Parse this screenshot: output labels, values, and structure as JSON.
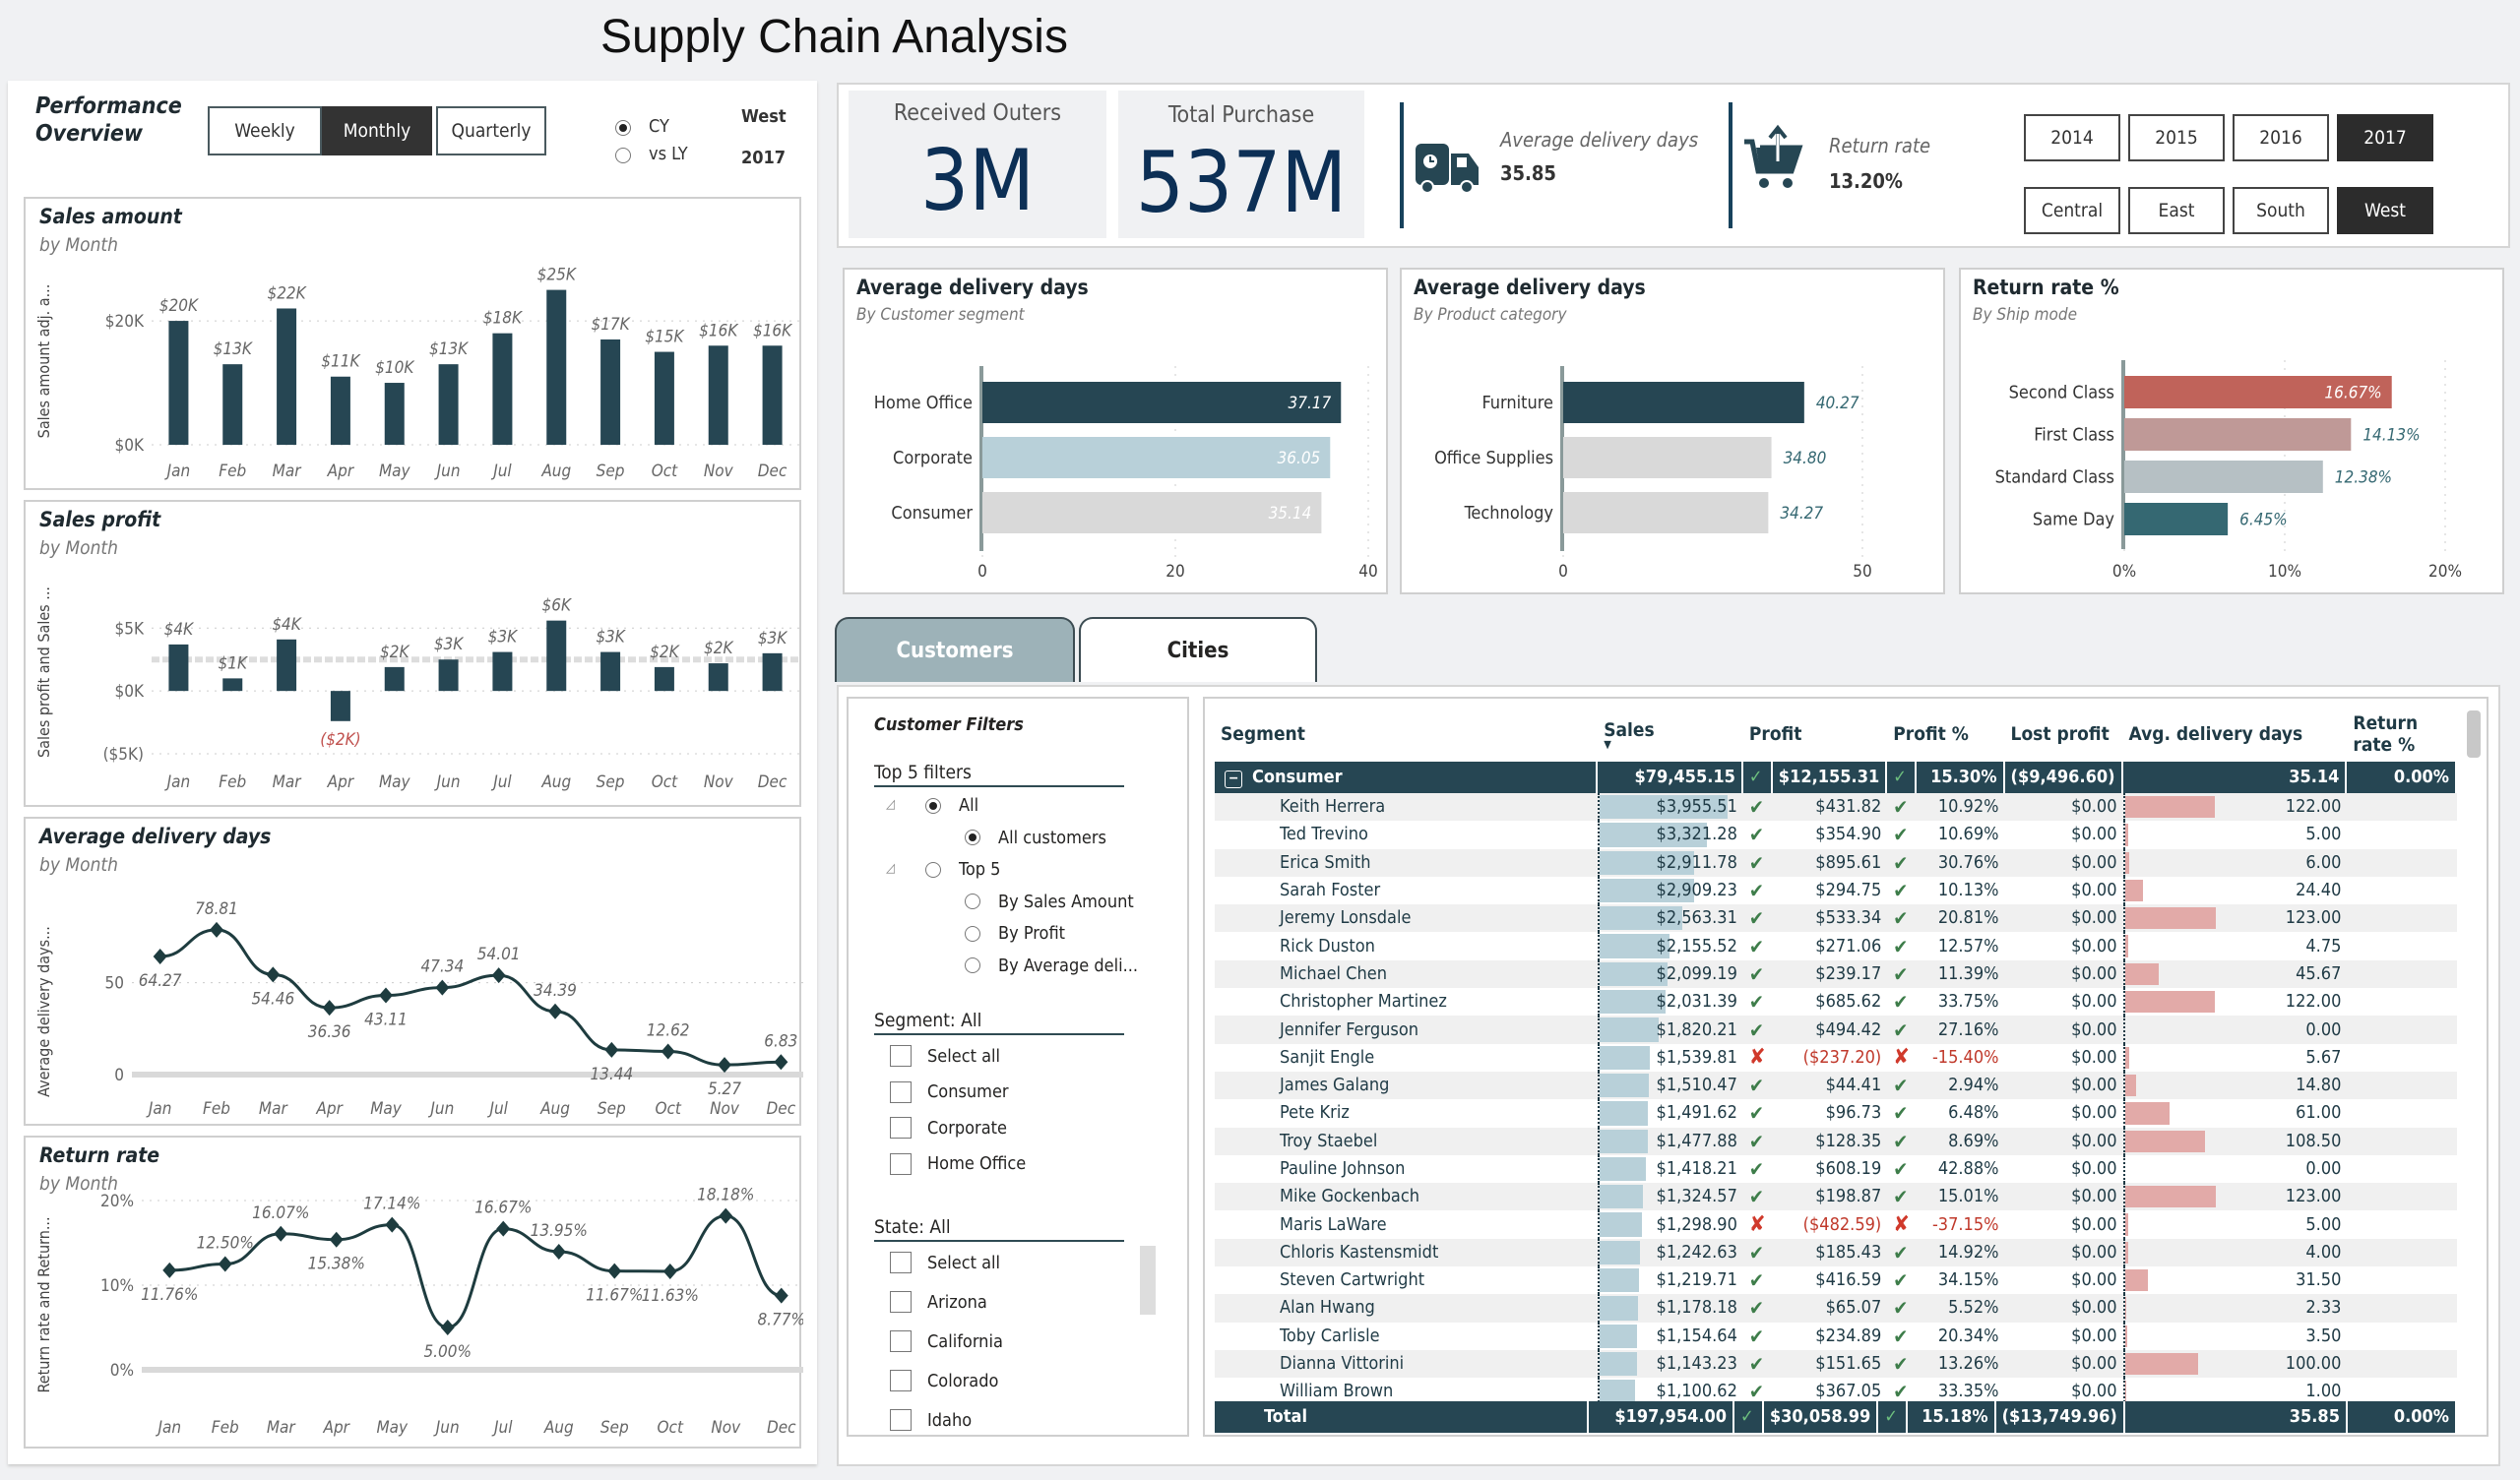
{
  "page_title": "Supply Chain Analysis",
  "perf": {
    "title_line1": "Performance",
    "title_line2": "Overview",
    "buttons": [
      {
        "label": "Weekly",
        "active": false
      },
      {
        "label": "Monthly",
        "active": true
      },
      {
        "label": "Quarterly",
        "active": false
      }
    ],
    "radios": [
      {
        "label": "CY",
        "checked": true
      },
      {
        "label": "vs LY",
        "checked": false
      }
    ],
    "region": "West",
    "year": "2017"
  },
  "kpis": {
    "received_label": "Received Outers",
    "received_value": "3M",
    "purchase_label": "Total Purchase",
    "purchase_value": "537M",
    "delivery_label": "Average delivery days",
    "delivery_value": "35.85",
    "return_label": "Return rate",
    "return_value": "13.20%"
  },
  "year_slicer": [
    {
      "label": "2014",
      "active": false
    },
    {
      "label": "2015",
      "active": false
    },
    {
      "label": "2016",
      "active": false
    },
    {
      "label": "2017",
      "active": true
    }
  ],
  "region_slicer": [
    {
      "label": "Central",
      "active": false
    },
    {
      "label": "East",
      "active": false
    },
    {
      "label": "South",
      "active": false
    },
    {
      "label": "West",
      "active": true
    }
  ],
  "tabs": [
    {
      "label": "Customers",
      "active": true
    },
    {
      "label": "Cities",
      "active": false
    }
  ],
  "filters": {
    "title": "Customer Filters",
    "top5_header": "Top 5 filters",
    "top5_tree": [
      {
        "label": "All",
        "level": 0,
        "state": "partial"
      },
      {
        "label": "All customers",
        "level": 1,
        "state": "on"
      },
      {
        "label": "Top 5",
        "level": 0,
        "state": "off"
      },
      {
        "label": "By Sales Amount",
        "level": 1,
        "state": "off"
      },
      {
        "label": "By Profit",
        "level": 1,
        "state": "off"
      },
      {
        "label": "By Average deli...",
        "level": 1,
        "state": "off"
      }
    ],
    "segment_header": "Segment: All",
    "segment_items": [
      "Select all",
      "Consumer",
      "Corporate",
      "Home Office"
    ],
    "state_header": "State: All",
    "state_items": [
      "Select all",
      "Arizona",
      "California",
      "Colorado",
      "Idaho"
    ]
  },
  "table": {
    "columns": [
      "Segment",
      "Sales",
      "Profit",
      "Profit %",
      "Lost profit",
      "Avg. delivery days",
      "Return rate %"
    ],
    "sort_column": "Sales",
    "segment_row": {
      "name": "Consumer",
      "sales": "$79,455.15",
      "profit": "$12,155.31",
      "profit_pct": "15.30%",
      "lost_profit": "($9,496.60)",
      "avg_days": "35.14",
      "return_rate": "0.00%"
    },
    "rows": [
      {
        "name": "Keith Herrera",
        "sales": "$3,955.51",
        "sales_v": 3955.51,
        "profit": "$431.82",
        "ok": true,
        "profit_pct": "10.92%",
        "lost": "$0.00",
        "days": "122.00",
        "days_v": 122
      },
      {
        "name": "Ted Trevino",
        "sales": "$3,321.28",
        "sales_v": 3321.28,
        "profit": "$354.90",
        "ok": true,
        "profit_pct": "10.69%",
        "lost": "$0.00",
        "days": "5.00",
        "days_v": 5
      },
      {
        "name": "Erica Smith",
        "sales": "$2,911.78",
        "sales_v": 2911.78,
        "profit": "$895.61",
        "ok": true,
        "profit_pct": "30.76%",
        "lost": "$0.00",
        "days": "6.00",
        "days_v": 6
      },
      {
        "name": "Sarah Foster",
        "sales": "$2,909.23",
        "sales_v": 2909.23,
        "profit": "$294.75",
        "ok": true,
        "profit_pct": "10.13%",
        "lost": "$0.00",
        "days": "24.40",
        "days_v": 24.4
      },
      {
        "name": "Jeremy Lonsdale",
        "sales": "$2,563.31",
        "sales_v": 2563.31,
        "profit": "$533.34",
        "ok": true,
        "profit_pct": "20.81%",
        "lost": "$0.00",
        "days": "123.00",
        "days_v": 123
      },
      {
        "name": "Rick Duston",
        "sales": "$2,155.52",
        "sales_v": 2155.52,
        "profit": "$271.06",
        "ok": true,
        "profit_pct": "12.57%",
        "lost": "$0.00",
        "days": "4.75",
        "days_v": 4.75
      },
      {
        "name": "Michael Chen",
        "sales": "$2,099.19",
        "sales_v": 2099.19,
        "profit": "$239.17",
        "ok": true,
        "profit_pct": "11.39%",
        "lost": "$0.00",
        "days": "45.67",
        "days_v": 45.67
      },
      {
        "name": "Christopher Martinez",
        "sales": "$2,031.39",
        "sales_v": 2031.39,
        "profit": "$685.62",
        "ok": true,
        "profit_pct": "33.75%",
        "lost": "$0.00",
        "days": "122.00",
        "days_v": 122
      },
      {
        "name": "Jennifer Ferguson",
        "sales": "$1,820.21",
        "sales_v": 1820.21,
        "profit": "$494.42",
        "ok": true,
        "profit_pct": "27.16%",
        "lost": "$0.00",
        "days": "0.00",
        "days_v": 0
      },
      {
        "name": "Sanjit Engle",
        "sales": "$1,539.81",
        "sales_v": 1539.81,
        "profit": "($237.20)",
        "ok": false,
        "profit_pct": "-15.40%",
        "lost": "$0.00",
        "days": "5.67",
        "days_v": 5.67
      },
      {
        "name": "James Galang",
        "sales": "$1,510.47",
        "sales_v": 1510.47,
        "profit": "$44.41",
        "ok": true,
        "profit_pct": "2.94%",
        "lost": "$0.00",
        "days": "14.80",
        "days_v": 14.8
      },
      {
        "name": "Pete Kriz",
        "sales": "$1,491.62",
        "sales_v": 1491.62,
        "profit": "$96.73",
        "ok": true,
        "profit_pct": "6.48%",
        "lost": "$0.00",
        "days": "61.00",
        "days_v": 61
      },
      {
        "name": "Troy Staebel",
        "sales": "$1,477.88",
        "sales_v": 1477.88,
        "profit": "$128.35",
        "ok": true,
        "profit_pct": "8.69%",
        "lost": "$0.00",
        "days": "108.50",
        "days_v": 108.5
      },
      {
        "name": "Pauline Johnson",
        "sales": "$1,418.21",
        "sales_v": 1418.21,
        "profit": "$608.19",
        "ok": true,
        "profit_pct": "42.88%",
        "lost": "$0.00",
        "days": "0.00",
        "days_v": 0
      },
      {
        "name": "Mike Gockenbach",
        "sales": "$1,324.57",
        "sales_v": 1324.57,
        "profit": "$198.87",
        "ok": true,
        "profit_pct": "15.01%",
        "lost": "$0.00",
        "days": "123.00",
        "days_v": 123
      },
      {
        "name": "Maris LaWare",
        "sales": "$1,298.90",
        "sales_v": 1298.9,
        "profit": "($482.59)",
        "ok": false,
        "profit_pct": "-37.15%",
        "lost": "$0.00",
        "days": "5.00",
        "days_v": 5
      },
      {
        "name": "Chloris Kastensmidt",
        "sales": "$1,242.63",
        "sales_v": 1242.63,
        "profit": "$185.43",
        "ok": true,
        "profit_pct": "14.92%",
        "lost": "$0.00",
        "days": "4.00",
        "days_v": 4
      },
      {
        "name": "Steven Cartwright",
        "sales": "$1,219.71",
        "sales_v": 1219.71,
        "profit": "$416.59",
        "ok": true,
        "profit_pct": "34.15%",
        "lost": "$0.00",
        "days": "31.50",
        "days_v": 31.5
      },
      {
        "name": "Alan Hwang",
        "sales": "$1,178.18",
        "sales_v": 1178.18,
        "profit": "$65.07",
        "ok": true,
        "profit_pct": "5.52%",
        "lost": "$0.00",
        "days": "2.33",
        "days_v": 2.33
      },
      {
        "name": "Toby Carlisle",
        "sales": "$1,154.64",
        "sales_v": 1154.64,
        "profit": "$234.89",
        "ok": true,
        "profit_pct": "20.34%",
        "lost": "$0.00",
        "days": "3.50",
        "days_v": 3.5
      },
      {
        "name": "Dianna Vittorini",
        "sales": "$1,143.23",
        "sales_v": 1143.23,
        "profit": "$151.65",
        "ok": true,
        "profit_pct": "13.26%",
        "lost": "$0.00",
        "days": "100.00",
        "days_v": 100
      },
      {
        "name": "William Brown",
        "sales": "$1,100.62",
        "sales_v": 1100.62,
        "profit": "$367.05",
        "ok": true,
        "profit_pct": "33.35%",
        "lost": "$0.00",
        "days": "1.00",
        "days_v": 1
      }
    ],
    "total_row": {
      "name": "Total",
      "sales": "$197,954.00",
      "profit": "$30,058.99",
      "profit_pct": "15.18%",
      "lost_profit": "($13,749.96)",
      "avg_days": "35.85",
      "return_rate": "0.00%"
    }
  },
  "chart_data": [
    {
      "id": "sales_amount",
      "type": "bar",
      "title": "Sales amount",
      "subtitle": "by Month",
      "ylabel": "Sales amount adj. a...",
      "categories": [
        "Jan",
        "Feb",
        "Mar",
        "Apr",
        "May",
        "Jun",
        "Jul",
        "Aug",
        "Sep",
        "Oct",
        "Nov",
        "Dec"
      ],
      "values": [
        20000,
        13000,
        22000,
        11000,
        10000,
        13000,
        18000,
        25000,
        17000,
        15000,
        16000,
        16000
      ],
      "labels": [
        "$20K",
        "$13K",
        "$22K",
        "$11K",
        "$10K",
        "$13K",
        "$18K",
        "$25K",
        "$17K",
        "$15K",
        "$16K",
        "$16K"
      ],
      "yticks": [
        {
          "v": 0,
          "label": "$0K"
        },
        {
          "v": 20000,
          "label": "$20K"
        }
      ],
      "ylim": [
        0,
        27000
      ],
      "color": "#264653"
    },
    {
      "id": "sales_profit",
      "type": "bar",
      "title": "Sales profit",
      "subtitle": "by Month",
      "ylabel": "Sales profit and Sales ...",
      "categories": [
        "Jan",
        "Feb",
        "Mar",
        "Apr",
        "May",
        "Jun",
        "Jul",
        "Aug",
        "Sep",
        "Oct",
        "Nov",
        "Dec"
      ],
      "values": [
        3700,
        1000,
        4100,
        -2400,
        1900,
        2500,
        3100,
        5600,
        3100,
        1900,
        2200,
        3000
      ],
      "labels": [
        "$4K",
        "$1K",
        "$4K",
        "($2K)",
        "$2K",
        "$3K",
        "$3K",
        "$6K",
        "$3K",
        "$2K",
        "$2K",
        "$3K"
      ],
      "yticks": [
        {
          "v": -5000,
          "label": "($5K)"
        },
        {
          "v": 0,
          "label": "$0K"
        },
        {
          "v": 5000,
          "label": "$5K"
        }
      ],
      "reference_line": 2500,
      "ylim": [
        -5000,
        8000
      ],
      "color": "#264653",
      "neg_label_color": "#c0504d"
    },
    {
      "id": "avg_delivery",
      "type": "line",
      "title": "Average delivery days",
      "subtitle": "by Month",
      "ylabel": "Average delivery days...",
      "categories": [
        "Jan",
        "Feb",
        "Mar",
        "Apr",
        "May",
        "Jun",
        "Jul",
        "Aug",
        "Sep",
        "Oct",
        "Nov",
        "Dec"
      ],
      "values": [
        64.27,
        78.81,
        54.46,
        36.36,
        43.11,
        47.34,
        54.01,
        34.39,
        13.44,
        12.62,
        5.27,
        6.83
      ],
      "yticks": [
        {
          "v": 0,
          "label": "0"
        },
        {
          "v": 50,
          "label": "50"
        }
      ],
      "ylim": [
        0,
        90
      ],
      "color": "#1e3c3f"
    },
    {
      "id": "return_rate",
      "type": "line",
      "title": "Return rate",
      "subtitle": "by Month",
      "ylabel": "Return rate and Return...",
      "categories": [
        "Jan",
        "Feb",
        "Mar",
        "Apr",
        "May",
        "Jun",
        "Jul",
        "Aug",
        "Sep",
        "Oct",
        "Nov",
        "Dec"
      ],
      "values": [
        11.76,
        12.5,
        16.07,
        15.38,
        17.14,
        5.0,
        16.67,
        13.95,
        11.67,
        11.63,
        18.18,
        8.77
      ],
      "value_suffix": "%",
      "yticks": [
        {
          "v": 0,
          "label": "0%"
        },
        {
          "v": 10,
          "label": "10%"
        },
        {
          "v": 20,
          "label": "20%"
        }
      ],
      "ylim": [
        0,
        20
      ],
      "color": "#1e3c3f"
    },
    {
      "id": "delivery_by_segment",
      "type": "bar",
      "orientation": "horizontal",
      "title": "Average delivery days",
      "subtitle": "By Customer segment",
      "categories": [
        "Home Office",
        "Corporate",
        "Consumer"
      ],
      "values": [
        37.17,
        36.05,
        35.14
      ],
      "colors": [
        "#264653",
        "#b8d0d9",
        "#d9d9d9"
      ],
      "label_inside": true,
      "xticks": [
        0,
        20,
        40
      ],
      "xlim": [
        0,
        40
      ]
    },
    {
      "id": "delivery_by_category",
      "type": "bar",
      "orientation": "horizontal",
      "title": "Average delivery days",
      "subtitle": "By Product category",
      "categories": [
        "Furniture",
        "Office Supplies",
        "Technology"
      ],
      "values": [
        40.27,
        34.8,
        34.27
      ],
      "colors": [
        "#264653",
        "#d9d9d9",
        "#d9d9d9"
      ],
      "label_inside": false,
      "xticks": [
        0,
        50
      ],
      "xlim": [
        0,
        50
      ]
    },
    {
      "id": "return_by_shipmode",
      "type": "bar",
      "orientation": "horizontal",
      "title": "Return rate %",
      "subtitle": "By Ship mode",
      "categories": [
        "Second Class",
        "First Class",
        "Standard Class",
        "Same Day"
      ],
      "values": [
        16.67,
        14.13,
        12.38,
        6.45
      ],
      "value_suffix": "%",
      "colors": [
        "#c0635a",
        "#bf9997",
        "#b6c0c4",
        "#356872"
      ],
      "xticks": [
        0,
        10,
        20
      ],
      "xtick_suffix": "%",
      "xlim": [
        0,
        20
      ]
    }
  ]
}
